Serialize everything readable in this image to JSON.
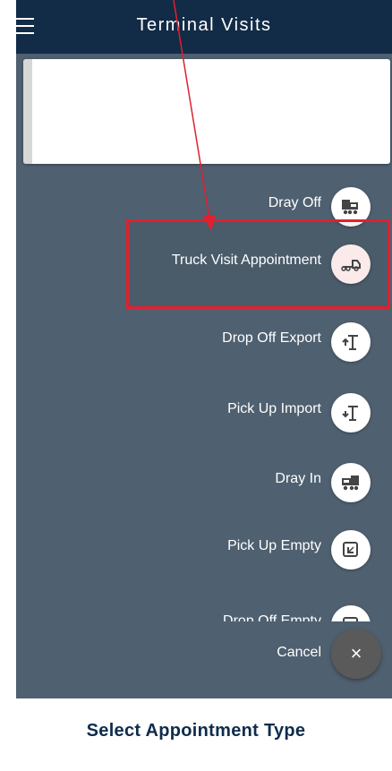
{
  "app": {
    "title": "Terminal Visits",
    "menu_icon": "hamburger-menu-icon"
  },
  "actions": [
    {
      "label": "Dray Off",
      "icon": "dray-off-icon"
    },
    {
      "label": "Truck Visit Appointment",
      "icon": "truck-visit-icon",
      "highlighted": true
    },
    {
      "label": "Drop Off Export",
      "icon": "drop-off-export-icon"
    },
    {
      "label": "Pick Up Import",
      "icon": "pick-up-import-icon"
    },
    {
      "label": "Dray In",
      "icon": "dray-in-icon"
    },
    {
      "label": "Pick Up Empty",
      "icon": "pick-up-empty-icon"
    },
    {
      "label": "Drop Off Empty",
      "icon": "drop-off-empty-icon"
    }
  ],
  "cancel": {
    "label": "Cancel",
    "glyph": "×"
  },
  "caption": "Select Appointment Type",
  "colors": {
    "appbar": "#122b46",
    "overlay": "#4f6070",
    "highlight": "#e0202f",
    "caption": "#0f2c4c"
  }
}
